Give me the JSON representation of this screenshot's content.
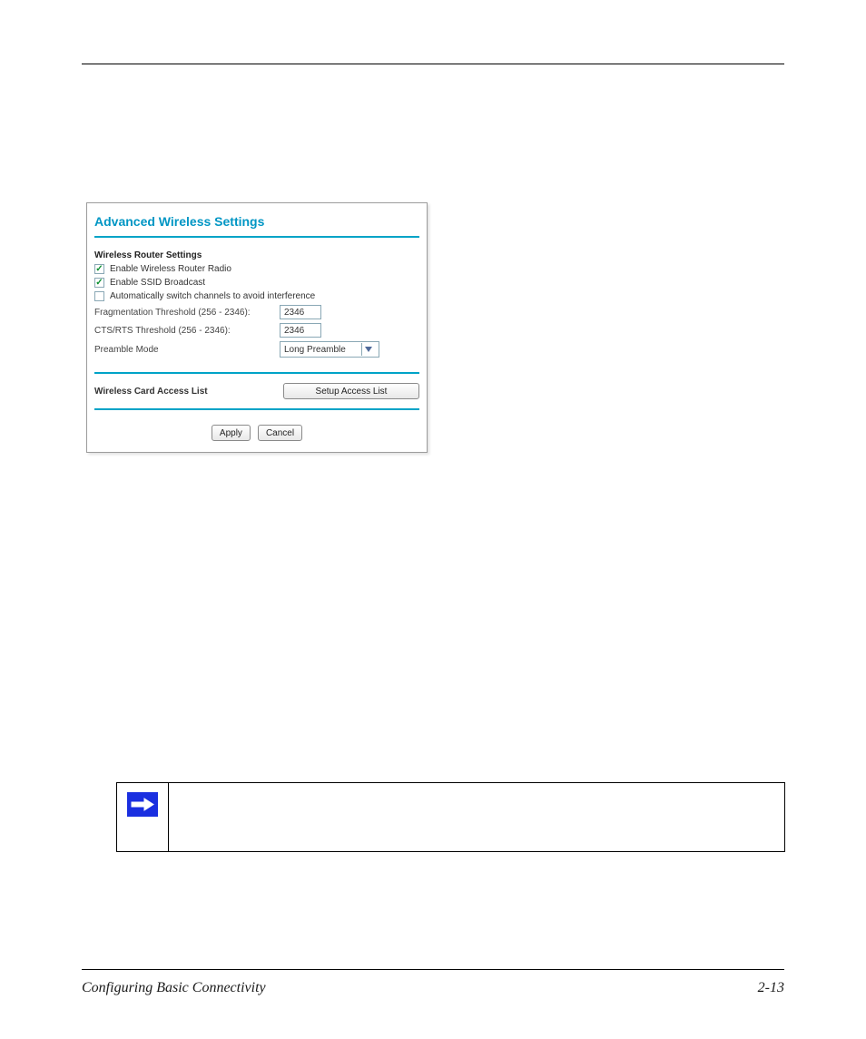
{
  "footer": {
    "left": "Configuring Basic Connectivity",
    "right": "2-13"
  },
  "panel": {
    "title": "Advanced Wireless Settings",
    "section_label": "Wireless Router Settings",
    "chk_enable_radio": {
      "checked": true,
      "label": "Enable Wireless Router Radio"
    },
    "chk_enable_ssid": {
      "checked": true,
      "label": "Enable SSID Broadcast"
    },
    "chk_auto_switch": {
      "checked": false,
      "label": "Automatically switch channels to avoid interference"
    },
    "frag": {
      "label": "Fragmentation Threshold (256 - 2346):",
      "value": "2346"
    },
    "cts": {
      "label": "CTS/RTS Threshold (256 - 2346):",
      "value": "2346"
    },
    "preamble": {
      "label": "Preamble Mode",
      "value": "Long Preamble"
    },
    "access_label": "Wireless Card Access List",
    "setup_button": "Setup Access List",
    "apply": "Apply",
    "cancel": "Cancel"
  },
  "note": {
    "icon": "arrow-right-icon"
  }
}
